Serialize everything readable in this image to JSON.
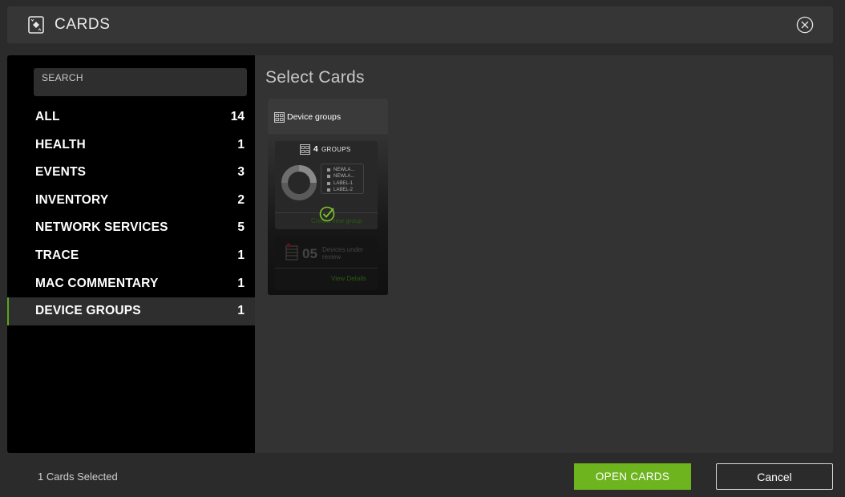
{
  "header": {
    "title": "CARDS",
    "icon": "cards-icon",
    "close_icon": "close-circle-icon"
  },
  "sidebar": {
    "search_placeholder": "SEARCH",
    "categories": [
      {
        "label": "ALL",
        "count": "14"
      },
      {
        "label": "HEALTH",
        "count": "1"
      },
      {
        "label": "EVENTS",
        "count": "3"
      },
      {
        "label": "INVENTORY",
        "count": "2"
      },
      {
        "label": "NETWORK SERVICES",
        "count": "5"
      },
      {
        "label": "TRACE",
        "count": "1"
      },
      {
        "label": "MAC COMMENTARY",
        "count": "1"
      },
      {
        "label": "DEVICE GROUPS",
        "count": "1"
      }
    ],
    "active_index": 7
  },
  "main": {
    "title": "Select Cards",
    "card": {
      "title": "Device groups",
      "icon": "device-groups-icon",
      "selected": true,
      "groups_count": "4",
      "groups_label": "GROUPS",
      "legend": [
        "NEWLA...",
        "NEWLA...",
        "LABEL-1",
        "LABEL-2"
      ],
      "create_link": "Create new group",
      "devices_count": "05",
      "devices_label": "Devices under review",
      "view_link": "View Details"
    }
  },
  "footer": {
    "status": "1 Cards Selected",
    "open_button": "OPEN CARDS",
    "cancel_button": "Cancel"
  },
  "colors": {
    "accent": "#6db41f",
    "active_border": "#5aa51e",
    "sidebar_bg": "#000000",
    "panel_bg": "#333333"
  }
}
